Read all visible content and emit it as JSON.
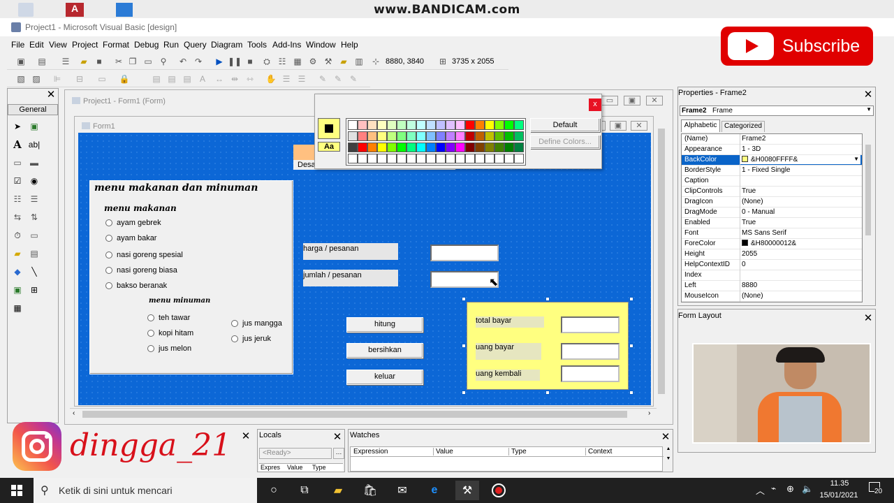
{
  "watermark": "www.BANDICAM.com",
  "window_title": "Project1 - Microsoft Visual Basic [design]",
  "menu": [
    "File",
    "Edit",
    "View",
    "Project",
    "Format",
    "Debug",
    "Run",
    "Query",
    "Diagram",
    "Tools",
    "Add-Ins",
    "Window",
    "Help"
  ],
  "toolbar": {
    "position": "8880, 3840",
    "size": "3735 x 2055"
  },
  "toolbox": {
    "title": "General"
  },
  "project_window_title": "Project1 - Form1 (Form)",
  "form": {
    "title": "Form1",
    "hidden_label": "Desa",
    "frame_title": "menu makanan dan minuman",
    "food_heading": "menu makanan",
    "food_options": [
      "ayam gebrek",
      "ayam bakar",
      "nasi goreng spesial",
      "nasi goreng biasa",
      "bakso beranak"
    ],
    "drink_heading": "menu minuman",
    "drink_options_left": [
      "teh tawar",
      "kopi hitam",
      "jus melon"
    ],
    "drink_options_right": [
      "jus mangga",
      "jus jeruk"
    ],
    "price_label": "harga / pesanan",
    "qty_label": "jumlah / pesanan",
    "btn_count": "hitung",
    "btn_clear": "bersihkan",
    "btn_exit": "keluar",
    "total_label": "total bayar",
    "paid_label": "uang bayar",
    "change_label": "uang kembali"
  },
  "palette": {
    "close": "x",
    "font_label": "Aa",
    "default_btn": "Default",
    "define_btn": "Define Colors...",
    "colors": [
      [
        "#ffffff",
        "#ffc0c0",
        "#ffe0c0",
        "#ffffc0",
        "#e0ffc0",
        "#c0ffc0",
        "#c0ffe0",
        "#c0ffff",
        "#c0e0ff",
        "#c0c0ff",
        "#e0c0ff",
        "#ffc0ff",
        "#ff0000",
        "#ff8000",
        "#ffff00",
        "#80ff00",
        "#00ff00",
        "#00ff80"
      ],
      [
        "#e0e0e0",
        "#ff8080",
        "#ffc080",
        "#ffff80",
        "#c0ff80",
        "#80ff80",
        "#80ffc0",
        "#80ffff",
        "#80c0ff",
        "#8080ff",
        "#c080ff",
        "#ff80ff",
        "#c00000",
        "#c06000",
        "#c0c000",
        "#60c000",
        "#00c000",
        "#00c060"
      ],
      [
        "#404040",
        "#ff0000",
        "#ff8000",
        "#ffff00",
        "#80ff00",
        "#00ff00",
        "#00ff80",
        "#00ffff",
        "#0080ff",
        "#0000ff",
        "#8000ff",
        "#ff00ff",
        "#800000",
        "#804000",
        "#808000",
        "#408000",
        "#008000",
        "#008040"
      ],
      [
        "#ffffff",
        "#ffffff",
        "#ffffff",
        "#ffffff",
        "#ffffff",
        "#ffffff",
        "#ffffff",
        "#ffffff",
        "#ffffff",
        "#ffffff",
        "#ffffff",
        "#ffffff",
        "#ffffff",
        "#ffffff",
        "#ffffff",
        "#ffffff",
        "#ffffff",
        "#ffffff"
      ]
    ]
  },
  "properties": {
    "title": "Properties - Frame2",
    "object": "Frame2",
    "object_type": "Frame",
    "tabs": [
      "Alphabetic",
      "Categorized"
    ],
    "rows": [
      {
        "k": "(Name)",
        "v": "Frame2"
      },
      {
        "k": "Appearance",
        "v": "1 - 3D"
      },
      {
        "k": "BackColor",
        "v": "&H0080FFFF&",
        "swatch": "#ffff80"
      },
      {
        "k": "BorderStyle",
        "v": "1 - Fixed Single"
      },
      {
        "k": "Caption",
        "v": ""
      },
      {
        "k": "ClipControls",
        "v": "True"
      },
      {
        "k": "DragIcon",
        "v": "(None)"
      },
      {
        "k": "DragMode",
        "v": "0 - Manual"
      },
      {
        "k": "Enabled",
        "v": "True"
      },
      {
        "k": "Font",
        "v": "MS Sans Serif"
      },
      {
        "k": "ForeColor",
        "v": "&H80000012&",
        "swatch": "#000000"
      },
      {
        "k": "Height",
        "v": "2055"
      },
      {
        "k": "HelpContextID",
        "v": "0"
      },
      {
        "k": "Index",
        "v": ""
      },
      {
        "k": "Left",
        "v": "8880"
      },
      {
        "k": "MouseIcon",
        "v": "(None)"
      }
    ]
  },
  "form_layout": {
    "title": "Form Layout"
  },
  "subscribe": "Subscribe",
  "insta_name": "dingga_21",
  "locals": {
    "title": "Locals",
    "ready": "<Ready>",
    "cols": [
      "Expres",
      "Value",
      "Type"
    ]
  },
  "watches": {
    "title": "Watches",
    "cols": [
      "Expression",
      "Value",
      "Type",
      "Context"
    ]
  },
  "taskbar": {
    "search": "Ketik di sini untuk mencari",
    "time": "11.35",
    "date": "15/01/2021",
    "notif": "20"
  }
}
